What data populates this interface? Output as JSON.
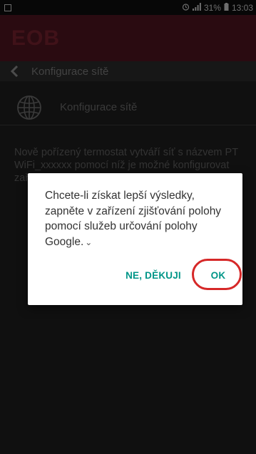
{
  "status_bar": {
    "alarm_icon": "alarm-icon",
    "signal_icon": "signal-icon",
    "battery": "31%",
    "time": "13:03"
  },
  "header": {
    "logo_text": "EOB",
    "brand_color": "#4e1420"
  },
  "nav": {
    "title": "Konfigurace sítě",
    "back_icon": "chevron-left-icon"
  },
  "config_item": {
    "label": "Konfigurace sítě",
    "icon": "globe-icon"
  },
  "description": "Nově pořízený termostat vytváří síť s názvem PT WiFi_xxxxxx pomocí níž je možné konfigurovat zařízení. Ujistěte se, že jste připojeni k této síti",
  "dialog": {
    "message": "Chcete-li získat lepší výsledky, zapněte v zařízení zjišťování polohy pomocí služeb určování polohy Google.",
    "no_label": "NE, DĚKUJI",
    "ok_label": "OK",
    "accent_color": "#009688",
    "highlight_color": "#d62828"
  }
}
